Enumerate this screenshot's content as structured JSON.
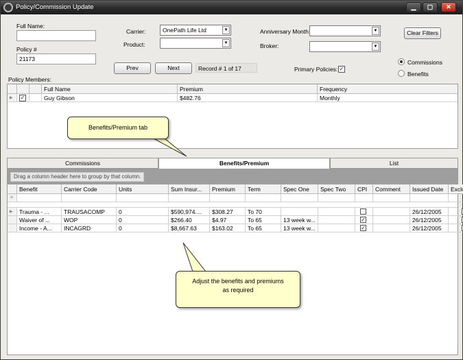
{
  "window": {
    "title": "Policy/Commission Update",
    "minimize": "▁",
    "maximize": "▢",
    "close": "✕"
  },
  "form": {
    "full_name_label": "Full Name:",
    "full_name_value": "",
    "policy_label": "Policy #",
    "policy_value": "21173",
    "carrier_label": "Carrier:",
    "carrier_value": "OnePath Life Ltd",
    "product_label": "Product:",
    "product_value": "",
    "anniversary_label": "Anniversary Month:",
    "anniversary_value": "",
    "broker_label": "Broker:",
    "broker_value": "",
    "clear_filters": "Clear Filters",
    "prev": "Prev",
    "next": "Next",
    "record_text": "Record # 1 of 17",
    "primary_policies_label": "Primary Policies:",
    "primary_policies_checked": true,
    "radio_commissions": "Commissions",
    "radio_benefits": "Benefits",
    "selected_radio": "Commissions"
  },
  "members": {
    "label": "Policy Members:",
    "columns": [
      "Full Name",
      "Premium",
      "Frequency"
    ],
    "rows": [
      {
        "name": "Guy Gibson",
        "premium": "$482.76",
        "frequency": "Monthly",
        "checked": true
      }
    ]
  },
  "tabs": [
    {
      "label": "Commissions",
      "active": false
    },
    {
      "label": "Benefits/Premium",
      "active": true
    },
    {
      "label": "List",
      "active": false
    }
  ],
  "grid": {
    "group_hint": "Drag a column header here to group by that column.",
    "columns": [
      "Benefit",
      "Carrier Code",
      "Units",
      "Sum Insur...",
      "Premium",
      "Term",
      "Spec One",
      "Spec Two",
      "CPI",
      "Comment",
      "Issued Date",
      "Exclusions"
    ],
    "rows": [
      {
        "benefit": "Trauma - ...",
        "carrier_code": "TRAUSACOMP",
        "units": "0",
        "sum_insured": "$590,974....",
        "premium": "$308.27",
        "term": "To 70",
        "spec_one": "",
        "spec_two": "",
        "cpi": false,
        "comment": "",
        "issued_date": "26/12/2005",
        "exclusions": false
      },
      {
        "benefit": "Waiver of ...",
        "carrier_code": "WOP",
        "units": "0",
        "sum_insured": "$266.40",
        "premium": "$4.97",
        "term": "To 65",
        "spec_one": "13 week w...",
        "spec_two": "",
        "cpi": true,
        "comment": "",
        "issued_date": "26/12/2005",
        "exclusions": true
      },
      {
        "benefit": "Income - A...",
        "carrier_code": "INCAGRD",
        "units": "0",
        "sum_insured": "$8,667.63",
        "premium": "$163.02",
        "term": "To 65",
        "spec_one": "13 week w...",
        "spec_two": "",
        "cpi": true,
        "comment": "",
        "issued_date": "26/12/2005",
        "exclusions": true
      }
    ]
  },
  "callouts": {
    "tab_note": "Benefits/Premium tab",
    "adjust_line1": "Adjust the benefits and premiums",
    "adjust_line2": "as required"
  },
  "colors": {
    "title_bar": "#2c2c2c",
    "window_bg": "#ebeae6",
    "callout_bg": "#ffffcc",
    "group_area": "#9e9e9e"
  }
}
